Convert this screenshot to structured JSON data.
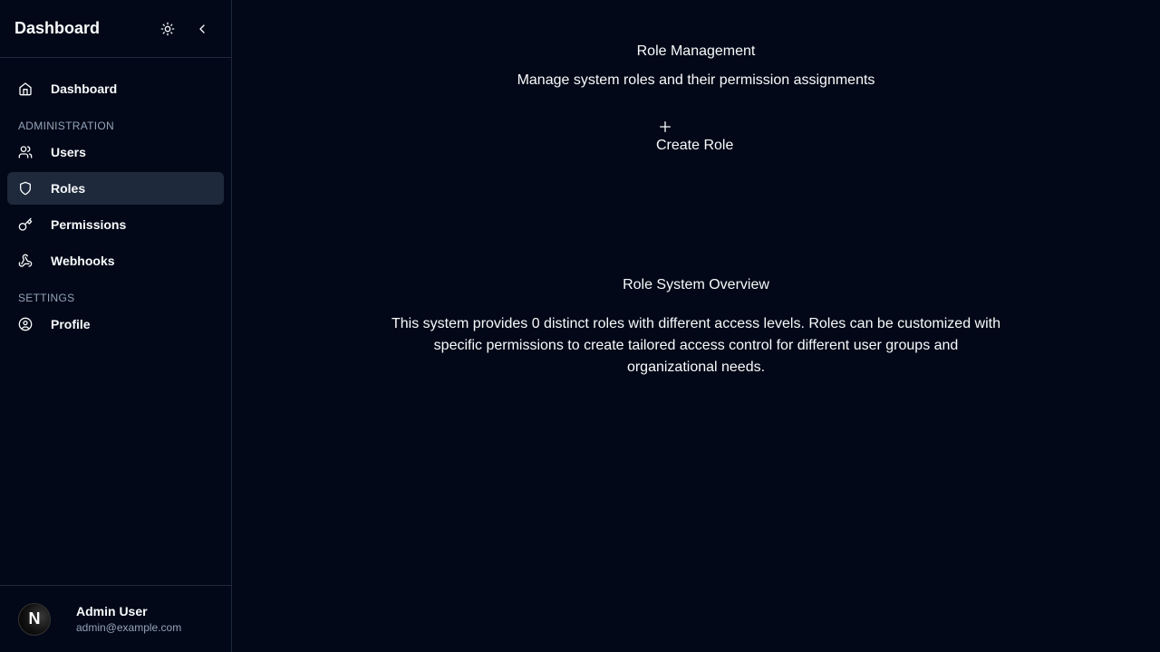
{
  "sidebar": {
    "title": "Dashboard",
    "theme_toggle_icon": "sun-icon",
    "collapse_icon": "chevron-left-icon",
    "nav_top": [
      {
        "label": "Dashboard",
        "icon": "home-icon"
      }
    ],
    "sections": [
      {
        "label": "ADMINISTRATION",
        "items": [
          {
            "label": "Users",
            "icon": "users-icon"
          },
          {
            "label": "Roles",
            "icon": "shield-icon",
            "active": true
          },
          {
            "label": "Permissions",
            "icon": "key-icon"
          },
          {
            "label": "Webhooks",
            "icon": "webhook-icon"
          }
        ]
      },
      {
        "label": "SETTINGS",
        "items": [
          {
            "label": "Profile",
            "icon": "user-circle-icon"
          }
        ]
      }
    ],
    "user": {
      "avatar_letter": "N",
      "name": "Admin User",
      "email": "admin@example.com"
    }
  },
  "main": {
    "title": "Role Management",
    "subtitle": "Manage system roles and their permission assignments",
    "create_button": {
      "label": "Create Role",
      "icon": "plus-icon"
    },
    "overview": {
      "title": "Role System Overview",
      "text": "This system provides 0 distinct roles with different access levels. Roles can be customized with specific permissions to create tailored access control for different user groups and organizational needs."
    }
  },
  "colors": {
    "background": "#020817",
    "border": "#1e293b",
    "active_item": "#1e293b",
    "muted_text": "#94a3b8",
    "text": "#f8fafc"
  }
}
